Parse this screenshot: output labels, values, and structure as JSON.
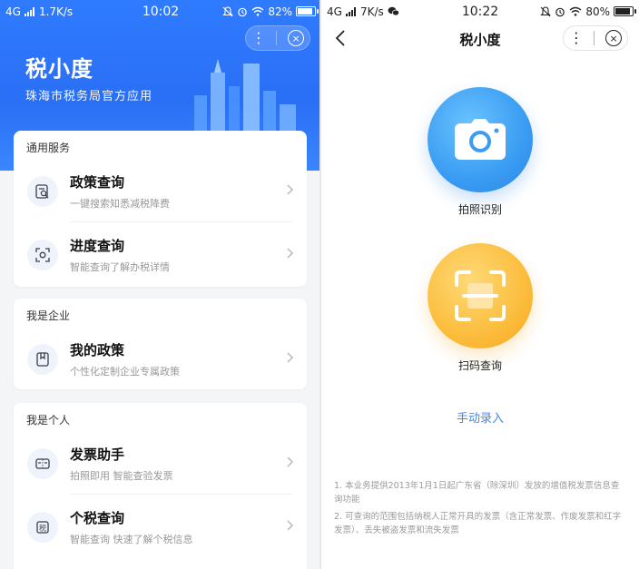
{
  "left": {
    "status": {
      "network": "4G",
      "speed": "1.7K/s",
      "time": "10:02",
      "battery": "82%",
      "battery_level": 0.82
    },
    "capsule": {
      "more": "⋮",
      "close": "×"
    },
    "header": {
      "title": "税小度",
      "subtitle": "珠海市税务局官方应用"
    },
    "sections": [
      {
        "title": "通用服务",
        "items": [
          {
            "name": "政策查询",
            "desc": "一键搜索知悉减税降费",
            "icon": "policy-search-icon"
          },
          {
            "name": "进度查询",
            "desc": "智能查询了解办税详情",
            "icon": "progress-scan-icon"
          }
        ]
      },
      {
        "title": "我是企业",
        "items": [
          {
            "name": "我的政策",
            "desc": "个性化定制企业专属政策",
            "icon": "bookmark-icon"
          }
        ]
      },
      {
        "title": "我是个人",
        "items": [
          {
            "name": "发票助手",
            "desc": "拍照即用 智能查验发票",
            "icon": "invoice-icon"
          },
          {
            "name": "个税查询",
            "desc": "智能查询 快速了解个税信息",
            "icon": "tax-icon"
          }
        ]
      }
    ]
  },
  "right": {
    "status": {
      "network": "4G",
      "speed": "7K/s",
      "time": "10:22",
      "battery": "80%",
      "battery_level": 0.8
    },
    "nav": {
      "title": "税小度"
    },
    "capsule": {
      "more": "⋮",
      "close": "×"
    },
    "photo_label": "拍照识别",
    "scan_label": "扫码查询",
    "manual_label": "手动录入",
    "notes": [
      "1. 本业务提供2013年1月1日起广东省（除深圳）发放的增值税发票信息查询功能",
      "2. 可查询的范围包括纳税人正常开具的发票（含正常发票、作废发票和红字发票）、丢失被盗发票和流失发票"
    ]
  },
  "colors": {
    "primary": "#2f7bff",
    "link": "#3f87f0",
    "scan_gold": "#fbbd3c",
    "photo_blue": "#3a9cf2"
  }
}
